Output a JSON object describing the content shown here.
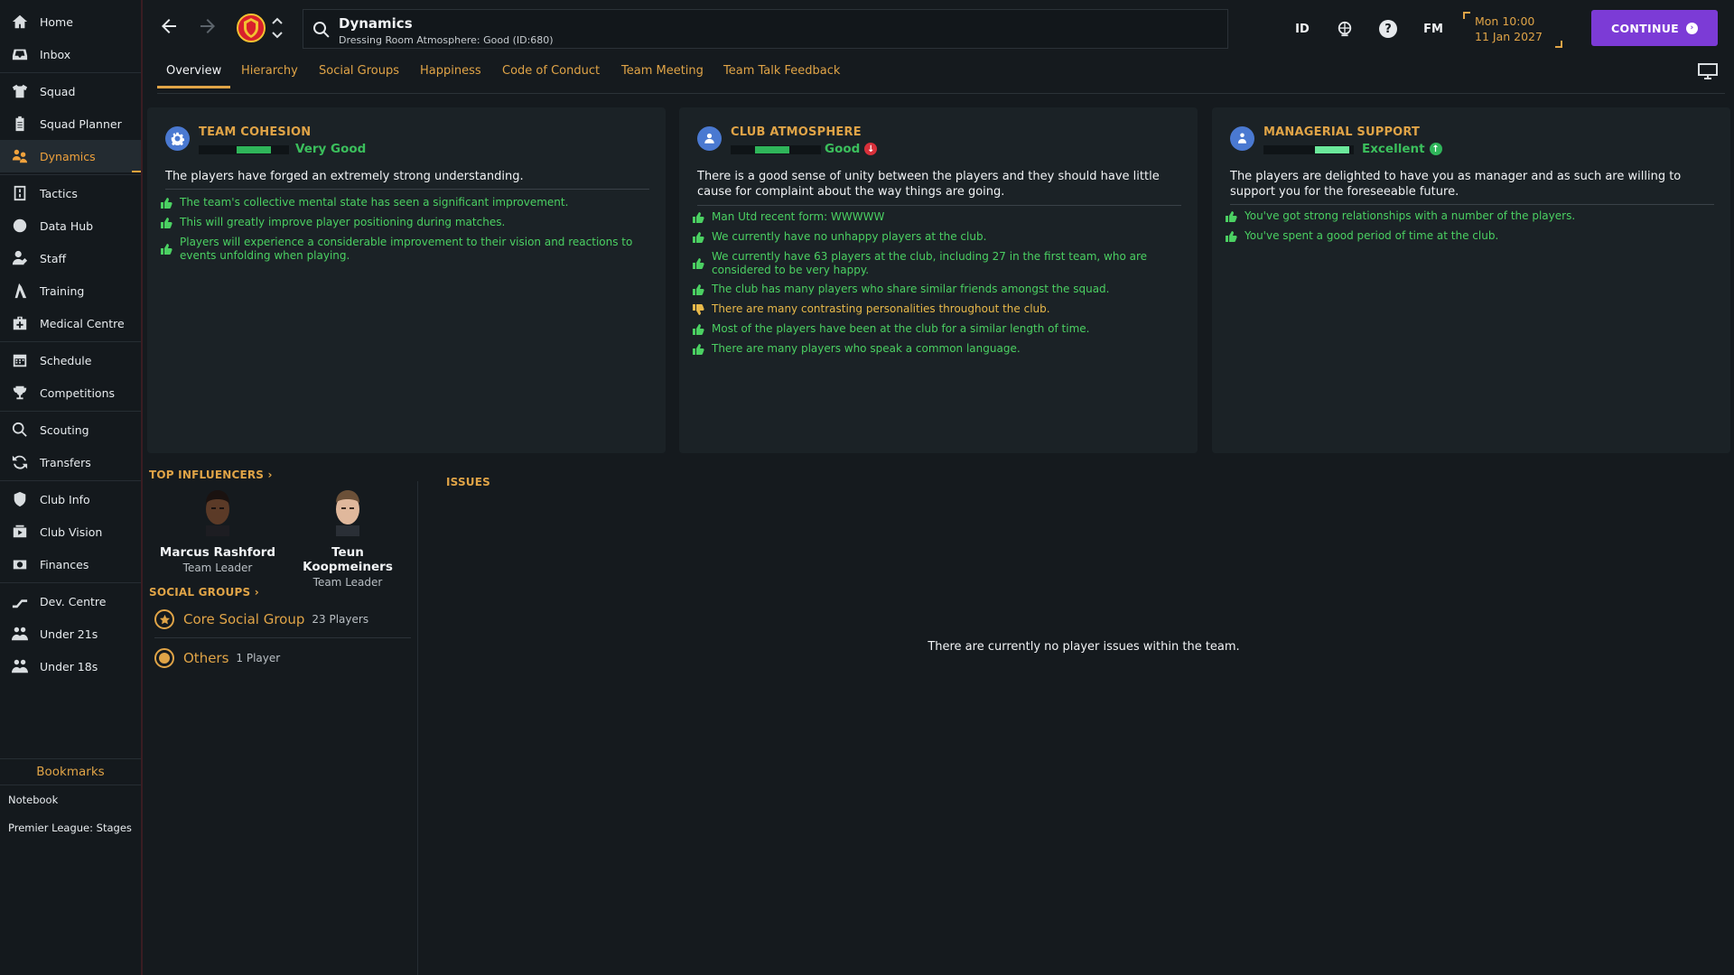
{
  "sidebar": {
    "items": [
      {
        "label": "Home",
        "icon": "home-icon"
      },
      {
        "label": "Inbox",
        "icon": "inbox-icon"
      },
      {
        "label": "Squad",
        "icon": "shirt-icon"
      },
      {
        "label": "Squad Planner",
        "icon": "clipboard-icon"
      },
      {
        "label": "Dynamics",
        "icon": "dynamics-icon",
        "active": true
      },
      {
        "label": "Tactics",
        "icon": "tactics-icon"
      },
      {
        "label": "Data Hub",
        "icon": "data-hub-icon"
      },
      {
        "label": "Staff",
        "icon": "staff-icon"
      },
      {
        "label": "Training",
        "icon": "training-icon"
      },
      {
        "label": "Medical Centre",
        "icon": "medical-icon"
      },
      {
        "label": "Schedule",
        "icon": "calendar-icon"
      },
      {
        "label": "Competitions",
        "icon": "trophy-icon"
      },
      {
        "label": "Scouting",
        "icon": "scouting-icon"
      },
      {
        "label": "Transfers",
        "icon": "transfers-icon"
      },
      {
        "label": "Club Info",
        "icon": "shield-icon"
      },
      {
        "label": "Club Vision",
        "icon": "vision-icon"
      },
      {
        "label": "Finances",
        "icon": "finances-icon"
      },
      {
        "label": "Dev. Centre",
        "icon": "dev-centre-icon"
      },
      {
        "label": "Under 21s",
        "icon": "under21-icon"
      },
      {
        "label": "Under 18s",
        "icon": "under18-icon"
      }
    ],
    "bookmarks_title": "Bookmarks",
    "bookmarks": [
      "Notebook",
      "Premier League: Stages"
    ]
  },
  "topbar": {
    "title": "Dynamics",
    "subtitle": "Dressing Room Atmosphere: Good (ID:680)",
    "id_button": "ID",
    "fm_button": "FM",
    "date_line1": "Mon 10:00",
    "date_line2": "11 Jan 2027",
    "continue_label": "CONTINUE"
  },
  "tabs": [
    {
      "label": "Overview",
      "active": true
    },
    {
      "label": "Hierarchy"
    },
    {
      "label": "Social Groups"
    },
    {
      "label": "Happiness"
    },
    {
      "label": "Code of Conduct"
    },
    {
      "label": "Team Meeting"
    },
    {
      "label": "Team Talk Feedback"
    }
  ],
  "cards": {
    "cohesion": {
      "title": "TEAM COHESION",
      "rating": "Very Good",
      "level": 0.8,
      "summary": "The players have forged an extremely strong understanding.",
      "reasons": [
        {
          "text": "The team's collective mental state has seen a significant improvement.",
          "type": "positive"
        },
        {
          "text": "This will greatly improve player positioning during matches.",
          "type": "positive"
        },
        {
          "text": "Players will experience a considerable improvement to their vision and reactions to events unfolding when playing.",
          "type": "positive"
        }
      ]
    },
    "atmosphere": {
      "title": "CLUB ATMOSPHERE",
      "rating": "Good",
      "level": 0.65,
      "trend": "down",
      "summary": "There is a good sense of unity between the players and they should have little cause for complaint about the way things are going.",
      "reasons": [
        {
          "text": "Man Utd recent form: WWWWW",
          "type": "positive"
        },
        {
          "text": "We currently have no unhappy players at the club.",
          "type": "positive"
        },
        {
          "text": "We currently have 63 players at the club, including 27 in the first team, who are considered to be very happy.",
          "type": "positive"
        },
        {
          "text": "The club has many players who share similar friends amongst the squad.",
          "type": "positive"
        },
        {
          "text": "There are many contrasting personalities throughout the club.",
          "type": "negative"
        },
        {
          "text": "Most of the players have been at the club for a similar length of time.",
          "type": "positive"
        },
        {
          "text": "There are many players who speak a common language.",
          "type": "positive"
        }
      ]
    },
    "support": {
      "title": "MANAGERIAL SUPPORT",
      "rating": "Excellent",
      "level": 0.95,
      "trend": "up",
      "summary": "The players are delighted to have you as manager and as such are willing to support you for the foreseeable future.",
      "reasons": [
        {
          "text": "You've got strong relationships with a number of the players.",
          "type": "positive"
        },
        {
          "text": "You've spent a good period of time at the club.",
          "type": "positive"
        }
      ]
    }
  },
  "influencers": {
    "title": "TOP INFLUENCERS",
    "players": [
      {
        "name": "Marcus Rashford",
        "role": "Team Leader"
      },
      {
        "name": "Teun Koopmeiners",
        "role": "Team Leader"
      }
    ]
  },
  "social_groups": {
    "title": "SOCIAL GROUPS",
    "groups": [
      {
        "name": "Core Social Group",
        "count": "23 Players",
        "icon": "star-icon"
      },
      {
        "name": "Others",
        "count": "1 Player",
        "icon": "circle-icon"
      }
    ]
  },
  "issues": {
    "title": "ISSUES",
    "empty_text": "There are currently no player issues within the team."
  },
  "colors": {
    "accent": "#e0a447",
    "positive": "#4bd062",
    "negative": "#e8b94a",
    "continue": "#7c3bd6",
    "icon_blue": "#4a79d1"
  }
}
